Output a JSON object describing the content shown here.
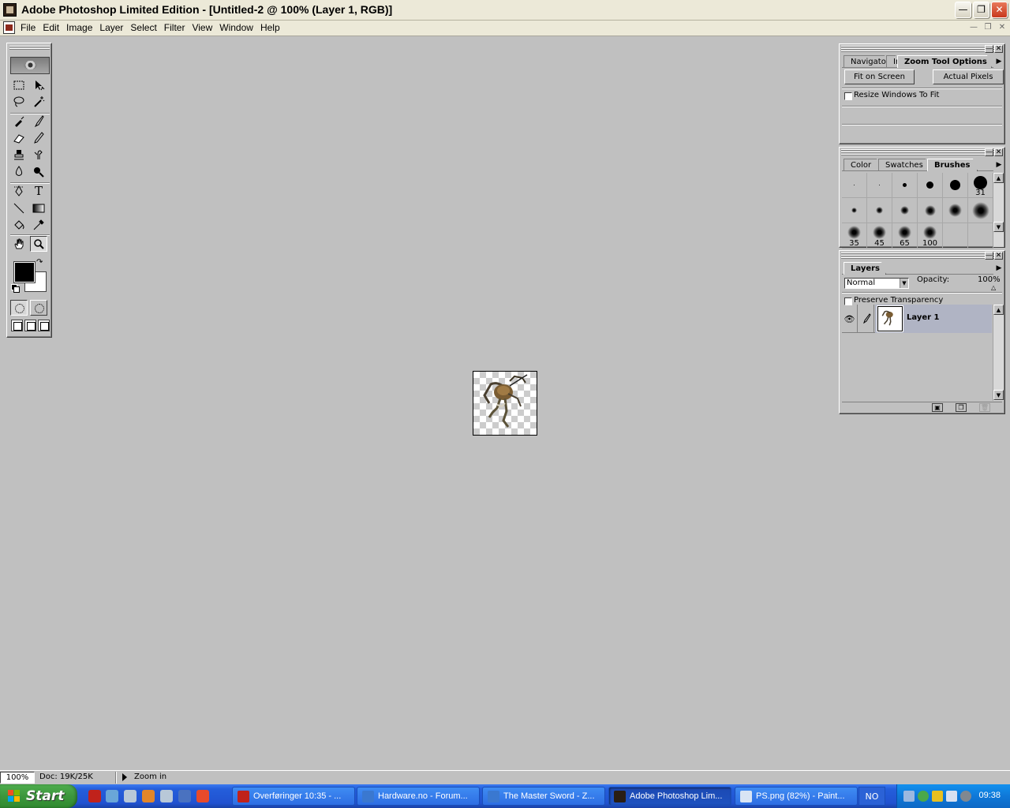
{
  "window": {
    "title": "Adobe Photoshop Limited Edition - [Untitled-2 @ 100%  (Layer 1, RGB)]",
    "controls": [
      "minimize",
      "restore",
      "close"
    ]
  },
  "menu": {
    "items": [
      "File",
      "Edit",
      "Image",
      "Layer",
      "Select",
      "Filter",
      "View",
      "Window",
      "Help"
    ]
  },
  "toolbox": {
    "tools": [
      "marquee-icon",
      "move-icon",
      "lasso-icon",
      "magic-wand-icon",
      "airbrush-icon",
      "paintbrush-icon",
      "eraser-icon",
      "pencil-icon",
      "rubber-stamp-icon",
      "smudge-icon",
      "blur-icon",
      "dodge-icon",
      "pen-icon",
      "type-icon",
      "line-icon",
      "gradient-icon",
      "paint-bucket-icon",
      "eyedropper-icon",
      "hand-icon",
      "zoom-icon"
    ],
    "type_tool_glyph": "T",
    "foreground_color": "#000000",
    "background_color": "#ffffff"
  },
  "zoom_palette": {
    "tabs": [
      "Navigator",
      "Info",
      "Zoom Tool Options"
    ],
    "active_tab": "Zoom Tool Options",
    "fit_button": "Fit on Screen",
    "actual_button": "Actual Pixels",
    "resize_label": "Resize Windows To Fit",
    "resize_checked": false
  },
  "brushes_palette": {
    "tabs": [
      "Color",
      "Swatches",
      "Brushes"
    ],
    "active_tab": "Brushes",
    "brushes": [
      {
        "label": "",
        "soft": false
      },
      {
        "label": "",
        "soft": false
      },
      {
        "label": "",
        "soft": false
      },
      {
        "label": "",
        "soft": false
      },
      {
        "label": "",
        "soft": false
      },
      {
        "label": "31",
        "soft": false
      },
      {
        "label": "",
        "soft": true
      },
      {
        "label": "",
        "soft": true
      },
      {
        "label": "",
        "soft": true
      },
      {
        "label": "",
        "soft": true
      },
      {
        "label": "",
        "soft": true
      },
      {
        "label": "",
        "soft": true
      },
      {
        "label": "35",
        "soft": true
      },
      {
        "label": "45",
        "soft": true
      },
      {
        "label": "65",
        "soft": true
      },
      {
        "label": "100",
        "soft": true
      },
      {
        "label": "",
        "soft": false
      },
      {
        "label": "",
        "soft": false
      }
    ]
  },
  "layers_palette": {
    "tab": "Layers",
    "blend_mode": "Normal",
    "opacity_label": "Opacity:",
    "opacity_value": "100%",
    "preserve_label": "Preserve Transparency",
    "preserve_checked": false,
    "layers": [
      {
        "name": "Layer 1",
        "visible": true
      }
    ]
  },
  "status": {
    "zoom": "100%",
    "doc": "Doc: 19K/25K",
    "hint": "Zoom in"
  },
  "taskbar": {
    "start_label": "Start",
    "tasks": [
      {
        "label": "Overføringer 10:35 - ...",
        "active": false
      },
      {
        "label": "Hardware.no - Forum...",
        "active": false
      },
      {
        "label": "The Master Sword - Z...",
        "active": false
      },
      {
        "label": "Adobe Photoshop Lim...",
        "active": true
      },
      {
        "label": "PS.png (82%) - Paint...",
        "active": false
      }
    ],
    "language": "NO",
    "clock": "09:38"
  }
}
